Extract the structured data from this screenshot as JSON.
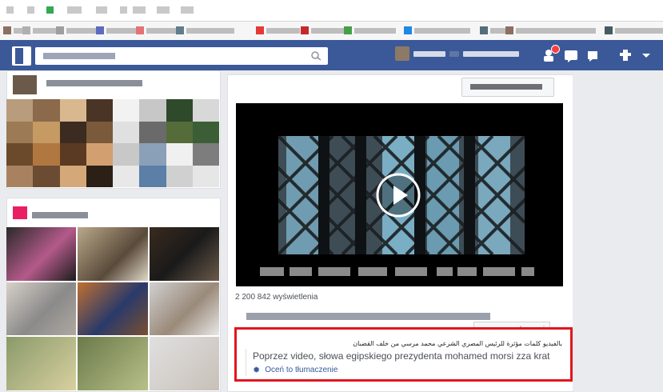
{
  "colors": {
    "fb_blue": "#3b5998",
    "highlight_red": "#e0161e",
    "link_blue": "#365899"
  },
  "post": {
    "views_text": "2 200 842 wyświetlenia",
    "follow_label": "obserwuj"
  },
  "translation": {
    "original_arabic": "بالفيديو كلمات مؤثرة للرئيس المصري الشرعي محمد مرسي من خلف القضبان",
    "translated_text": "Poprzez video, słowa egipskiego prezydenta mohamed morsi zza krat",
    "rate_label": "Oceń to tłumaczenie"
  },
  "icons": {
    "play": "play-icon",
    "gear": "gear-icon",
    "search": "search-icon",
    "share": "share-icon"
  }
}
